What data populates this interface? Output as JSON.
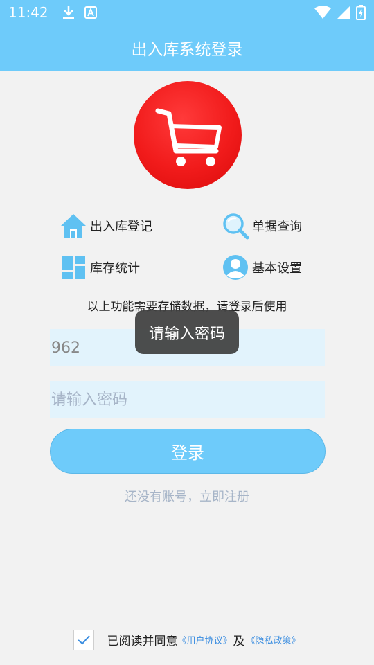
{
  "status_bar": {
    "time": "11:42"
  },
  "title_bar": {
    "title": "出入库系统登录"
  },
  "features": {
    "stock_register": "出入库登记",
    "document_query": "单据查询",
    "inventory_stats": "库存统计",
    "basic_settings": "基本设置"
  },
  "notice": "以上功能需要存储数据，请登录后使用",
  "form": {
    "username_value": "962",
    "password_placeholder": "请输入密码",
    "login_label": "登录",
    "register_link": "还没有账号，立即注册"
  },
  "toast": {
    "message": "请输入密码"
  },
  "agreement": {
    "text": "已阅读并同意",
    "user_agreement": "《用户协议》",
    "and": "及",
    "privacy_policy": "《隐私政策》",
    "checked": true
  },
  "colors": {
    "primary": "#6ecbfa",
    "logo_red": "#f11b1b",
    "input_bg": "#e2f3fc",
    "placeholder": "#a7b5c8",
    "link": "#3a8de0"
  }
}
